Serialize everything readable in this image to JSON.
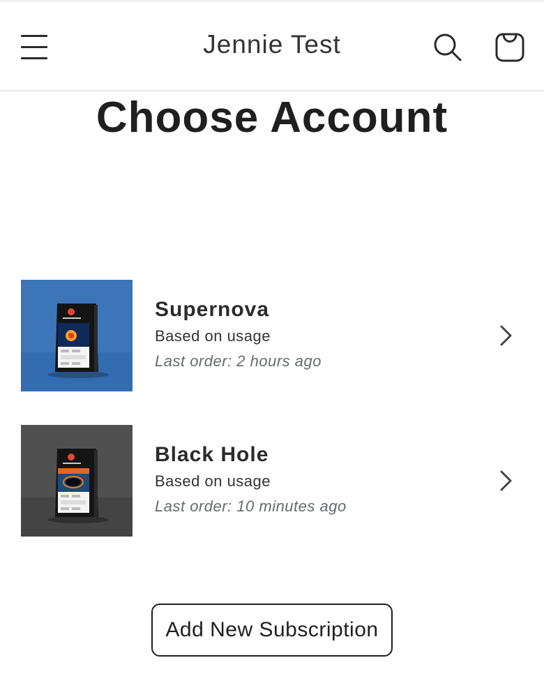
{
  "header": {
    "store_title": "Jennie Test",
    "menu_icon": "hamburger-menu-icon",
    "search_icon": "search-icon",
    "cart_icon": "cart-bag-icon"
  },
  "page": {
    "title": "Choose Account"
  },
  "accounts": [
    {
      "name": "Supernova",
      "plan": "Based on usage",
      "last_order": "Last order: 2 hours ago",
      "thumb_bg": "#3c75b8",
      "thumb_floor": "#336cb0",
      "bag_label": "Supernova"
    },
    {
      "name": "Black Hole",
      "plan": "Based on usage",
      "last_order": "Last order: 10 minutes ago",
      "thumb_bg": "#505050",
      "thumb_floor": "#444444",
      "bag_label": "Black Hole"
    }
  ],
  "actions": {
    "add_subscription": "Add New Subscription"
  },
  "colors": {
    "text": "#222222",
    "muted": "#666a70",
    "border": "#1f1f1f"
  }
}
